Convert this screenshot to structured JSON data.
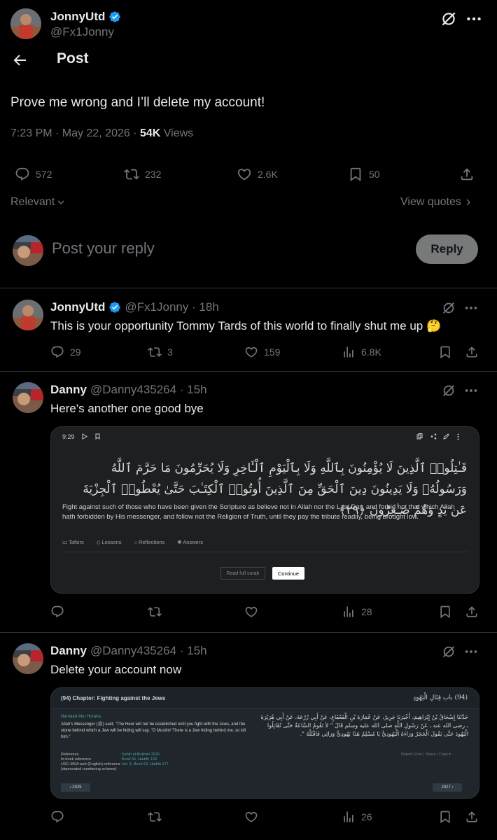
{
  "author": {
    "name": "JonnyUtd",
    "handle": "@Fx1Jonny",
    "verified": true
  },
  "header": {
    "title": "Post"
  },
  "post": {
    "text": "Prove me wrong and I’ll delete my account!",
    "time": "7:23 PM · May 22, 2026 · ",
    "views_count": "54K",
    "views_label": " Views",
    "replies": "572",
    "reposts": "232",
    "likes": "2.6K",
    "bookmarks": "50"
  },
  "sort": {
    "label": "Relevant",
    "view_quotes": "View quotes"
  },
  "reply_box": {
    "placeholder": "Post your reply",
    "button": "Reply"
  },
  "replies": [
    {
      "name": "JonnyUtd",
      "handle": "@Fx1Jonny · 18h",
      "verified": true,
      "text": "This is your opportunity Tommy Tards of this world to finally shut me up 🤔",
      "replies": "29",
      "reposts": "3",
      "likes": "159",
      "views": "6.8K"
    },
    {
      "name": "Danny",
      "handle": "@Danny435264 · 15h",
      "text": "Here's another one good bye",
      "views": "28",
      "embed": {
        "time": "9:29",
        "arabic": "قَـٰتِلُوا۟ ٱلَّذِينَ لَا يُؤْمِنُونَ بِٱللَّهِ وَلَا بِٱلْيَوْمِ ٱلْـَٔاخِرِ وَلَا يُحَرِّمُونَ مَا حَرَّمَ ٱللَّهُ وَرَسُولُهُۥ وَلَا يَدِينُونَ دِينَ ٱلْحَقِّ مِنَ ٱلَّذِينَ أُوتُوا۟ ٱلْكِتَـٰبَ حَتَّىٰ يُعْطُوا۟ ٱلْجِزْيَةَ عَن يَدٍ وَهُمْ صَـٰغِرُونَ ﴿٢٩﴾",
        "translation": "Fight against such of those who have been given the Scripture as believe not in Allah nor the Last Day, and forbid not that which Allah hath forbidden by His messenger, and follow not the Religion of Truth, until they pay the tribute readily, being brought low.",
        "tabs": [
          "Tafsirs",
          "Lessons",
          "Reflections",
          "Answers"
        ],
        "read_full": "Read full surah",
        "continue": "Continue"
      }
    },
    {
      "name": "Danny",
      "handle": "@Danny435264 · 15h",
      "text": "Delete your account now",
      "views": "26",
      "embed": {
        "chapter": "(94)   Chapter: Fighting against the Jews",
        "chapter_ar": "(94) باب قِتَالِ الْيَهُودِ",
        "narrated": "Narrated Abu Huraira:",
        "text": "Allah's Messenger (ﷺ) said, \"The Hour will not be established until you fight with the Jews, and the stone behind which a Jew will be hiding will say. \"O Muslim! There is a Jew hiding behind me, so kill him.\"",
        "arabic": "حَدَّثَنَا إِسْحَاقُ بْنُ إِبْرَاهِيمَ، أَخْبَرَنَا جَرِيرٌ، عَنْ عُمَارَةَ بْنِ الْقَعْقَاعِ، عَنْ أَبِي زُرْعَةَ، عَنْ أَبِي هُرَيْرَةَ ـ رضى الله عنه ـ عَنْ رَسُولِ اللَّهِ صلى الله عليه وسلم قَالَ ‏\"‏ لاَ تَقُومُ السَّاعَةُ حَتَّى تُقَاتِلُوا الْيَهُودَ حَتَّى يَقُولَ الْحَجَرُ وَرَاءَهُ الْيَهُودِيُّ يَا مُسْلِمُ هَذَا يَهُودِيٌّ وَرَائِي فَاقْتُلْهُ ‏\"‏‏.‏",
        "ref_labels": "Reference\nIn-book reference\nUSC-MSA web (English) reference\n(deprecated numbering scheme)",
        "ref_values": ": Sahih al-Bukhari 2926\n: Book 56, Hadith 139\n: Vol. 4, Book 52, Hadith 177",
        "report": "Report Error | Share | Copy ▾",
        "prev": "‹ 2925",
        "next": "2927 ›"
      }
    }
  ],
  "colors": {
    "background": "#000000",
    "text": "#e7e9ea",
    "secondary": "#71767b",
    "verified": "#1d9bf0",
    "divider": "#2f3336"
  }
}
